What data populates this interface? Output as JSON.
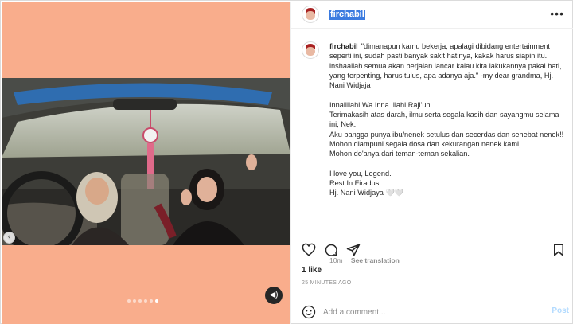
{
  "header": {
    "username": "firchabil",
    "more_label": "•••"
  },
  "caption": {
    "username": "firchabil",
    "lines": [
      "\"dimanapun kamu bekerja, apalagi dibidang entertainment seperti ini, sudah pasti banyak sakit hatinya, kakak harus siapin itu. inshaallah semua akan berjalan lancar kalau kita lakukannya pakai hati, yang terpenting, harus tulus, apa adanya aja.\" -my dear grandma, Hj. Nani Widjaja",
      "",
      "Innalillahi Wa Inna Illahi Raji'un...",
      "Terimakasih atas darah, ilmu serta segala kasih dan sayangmu selama ini, Nek.",
      "Aku bangga punya ibu/nenek setulus dan secerdas dan sehebat nenek!!",
      "Mohon diampuni segala dosa dan kekurangan nenek kami,",
      "Mohon do'anya dari teman-teman sekalian.",
      "",
      "I love you, Legend.",
      "Rest In Firadus,",
      "Hj. Nani Widjaya 🤍🤍"
    ]
  },
  "meta": {
    "age": "10m",
    "see_translation": "See translation"
  },
  "likes": "1 like",
  "timestamp": "25 MINUTES AGO",
  "comment": {
    "placeholder": "Add a comment...",
    "post_label": "Post"
  },
  "carousel": {
    "total": 6,
    "active_index": 5
  },
  "colors": {
    "media_background": "#f9ad8c",
    "username_highlight": "#3b7be0",
    "post_disabled": "#b3dbff"
  }
}
